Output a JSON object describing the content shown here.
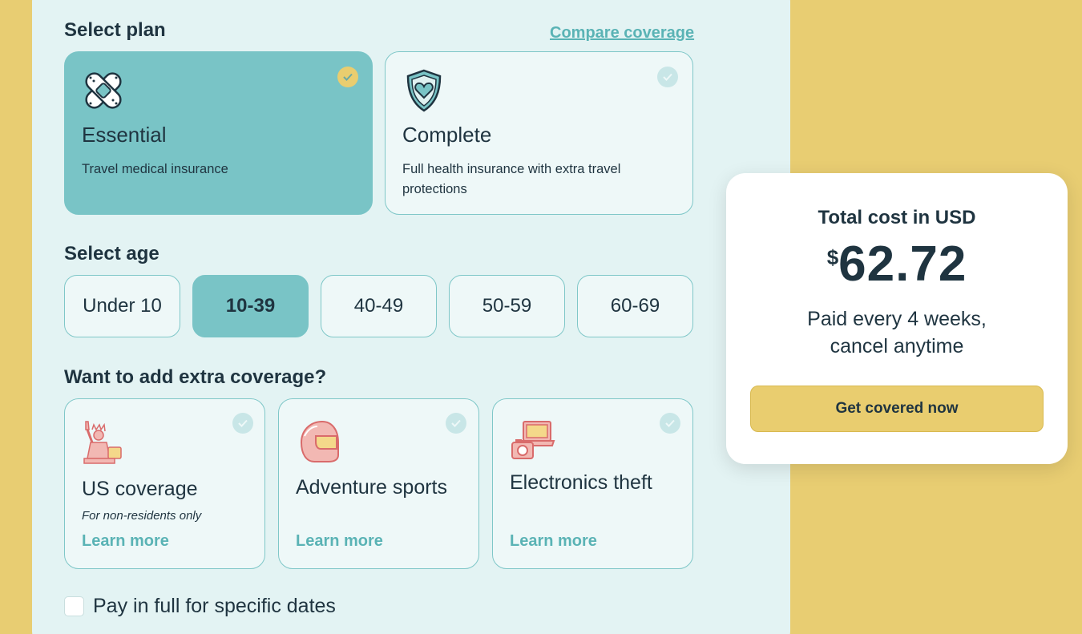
{
  "plan": {
    "title": "Select plan",
    "compare_link": "Compare coverage",
    "options": [
      {
        "name": "Essential",
        "description": "Travel medical insurance",
        "selected": true,
        "icon": "bandage-icon"
      },
      {
        "name": "Complete",
        "description": "Full health insurance with extra travel protections",
        "selected": false,
        "icon": "shield-heart-icon"
      }
    ]
  },
  "age": {
    "title": "Select age",
    "options": [
      "Under 10",
      "10-39",
      "40-49",
      "50-59",
      "60-69"
    ],
    "selected": "10-39"
  },
  "coverage": {
    "title": "Want to add extra coverage?",
    "options": [
      {
        "name": "US coverage",
        "note": "For non-residents only",
        "link": "Learn more",
        "icon": "statue-of-liberty-icon"
      },
      {
        "name": "Adventure sports",
        "link": "Learn more",
        "icon": "helmet-icon"
      },
      {
        "name": "Electronics theft",
        "link": "Learn more",
        "icon": "electronics-icon"
      }
    ]
  },
  "pay_full": {
    "label": "Pay in full for specific dates",
    "checked": false
  },
  "summary": {
    "label": "Total cost in USD",
    "currency": "$",
    "amount": "62.72",
    "billing": "Paid every 4 weeks, cancel anytime",
    "cta": "Get covered now"
  },
  "colors": {
    "background": "#e8cd72",
    "panel": "#e3f3f3",
    "selected": "#79c4c6",
    "accent": "#5ab3b5",
    "cta": "#e9cd6f"
  }
}
